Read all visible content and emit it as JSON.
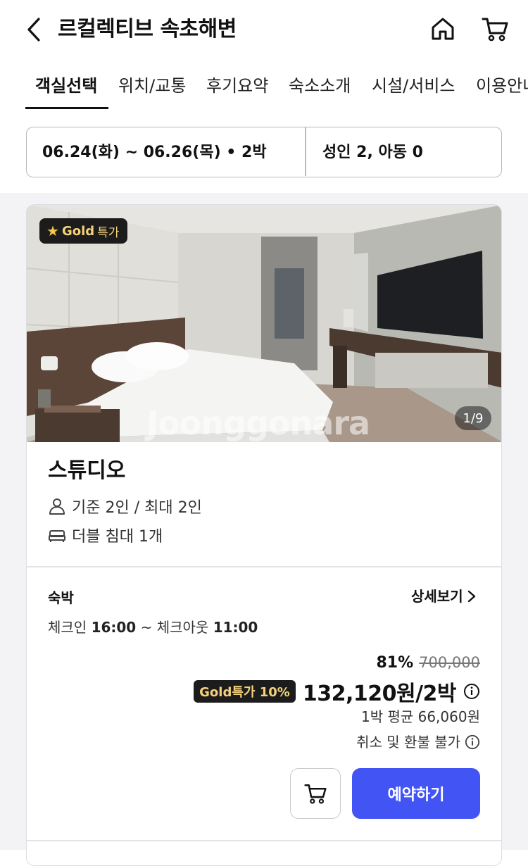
{
  "header": {
    "title": "르컬렉티브 속초해변"
  },
  "tabs": [
    {
      "label": "객실선택",
      "active": true
    },
    {
      "label": "위치/교통",
      "active": false
    },
    {
      "label": "후기요약",
      "active": false
    },
    {
      "label": "숙소소개",
      "active": false
    },
    {
      "label": "시설/서비스",
      "active": false
    },
    {
      "label": "이용안내",
      "active": false
    }
  ],
  "booking": {
    "dates": "06.24(화) ~ 06.26(목) • 2박",
    "guests": "성인 2, 아동 0"
  },
  "room": {
    "badge_gold": "Gold",
    "badge_deal": "특가",
    "photo_counter": "1/9",
    "watermark": "Joonggonara",
    "name": "스튜디오",
    "occupancy": "기준 2인 / 최대 2인",
    "bed": "더블 침대 1개"
  },
  "offer": {
    "stay_type": "숙박",
    "detail_link": "상세보기",
    "checkin_label": "체크인",
    "checkin_time": "16:00",
    "separator": "~",
    "checkout_label": "체크아웃",
    "checkout_time": "11:00",
    "discount_percent": "81%",
    "original_price": "700,000",
    "gold_tag": "Gold특가 10%",
    "price": "132,120원/2박",
    "avg_price": "1박 평균 66,060원",
    "refund_policy": "취소 및 환불 불가",
    "reserve_label": "예약하기"
  },
  "colors": {
    "accent": "#4354f5",
    "gold_text": "#f5d27a",
    "badge_bg": "#1c1c1c"
  },
  "icons": [
    "back-arrow-icon",
    "home-icon",
    "cart-icon",
    "star-icon",
    "person-icon",
    "bed-icon",
    "chevron-right-icon",
    "info-icon"
  ]
}
